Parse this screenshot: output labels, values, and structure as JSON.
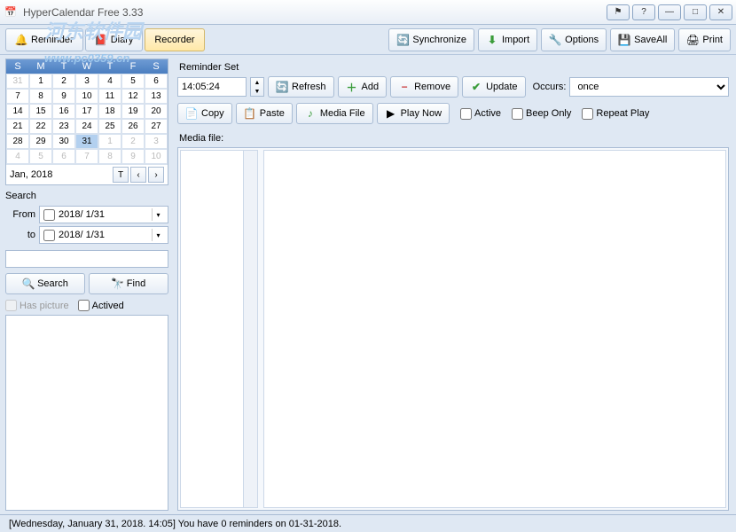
{
  "titlebar": {
    "title": "HyperCalendar Free 3.33",
    "watermark": "河东软件园\nwww.pc0359.cn"
  },
  "tabs": {
    "reminder": "Reminder",
    "diary": "Diary",
    "recorder": "Recorder"
  },
  "toolbar": {
    "synchronize": "Synchronize",
    "import": "Import",
    "options": "Options",
    "saveall": "SaveAll",
    "print": "Print"
  },
  "calendar": {
    "dow": [
      "S",
      "M",
      "T",
      "W",
      "T",
      "F",
      "S"
    ],
    "month_label": "Jan, 2018",
    "today_btn": "T",
    "cells": [
      {
        "d": "31",
        "dim": true
      },
      {
        "d": "1"
      },
      {
        "d": "2"
      },
      {
        "d": "3"
      },
      {
        "d": "4"
      },
      {
        "d": "5"
      },
      {
        "d": "6"
      },
      {
        "d": "7"
      },
      {
        "d": "8"
      },
      {
        "d": "9"
      },
      {
        "d": "10"
      },
      {
        "d": "11"
      },
      {
        "d": "12"
      },
      {
        "d": "13"
      },
      {
        "d": "14"
      },
      {
        "d": "15"
      },
      {
        "d": "16"
      },
      {
        "d": "17"
      },
      {
        "d": "18"
      },
      {
        "d": "19"
      },
      {
        "d": "20"
      },
      {
        "d": "21"
      },
      {
        "d": "22"
      },
      {
        "d": "23"
      },
      {
        "d": "24"
      },
      {
        "d": "25"
      },
      {
        "d": "26"
      },
      {
        "d": "27"
      },
      {
        "d": "28"
      },
      {
        "d": "29"
      },
      {
        "d": "30"
      },
      {
        "d": "31",
        "sel": true
      },
      {
        "d": "1",
        "dim": true
      },
      {
        "d": "2",
        "dim": true
      },
      {
        "d": "3",
        "dim": true
      },
      {
        "d": "4",
        "dim": true
      },
      {
        "d": "5",
        "dim": true
      },
      {
        "d": "6",
        "dim": true
      },
      {
        "d": "7",
        "dim": true
      },
      {
        "d": "8",
        "dim": true
      },
      {
        "d": "9",
        "dim": true
      },
      {
        "d": "10",
        "dim": true
      }
    ]
  },
  "search": {
    "title": "Search",
    "from_label": "From",
    "to_label": "to",
    "from_value": "2018/ 1/31",
    "to_value": "2018/ 1/31",
    "search_btn": "Search",
    "find_btn": "Find",
    "has_picture": "Has picture",
    "actived": "Actived"
  },
  "reminder": {
    "section": "Reminder Set",
    "time_value": "14:05:24",
    "refresh": "Refresh",
    "add": "Add",
    "remove": "Remove",
    "update": "Update",
    "occurs_label": "Occurs:",
    "occurs_value": "once",
    "copy": "Copy",
    "paste": "Paste",
    "media_file_btn": "Media File",
    "play_now": "Play Now",
    "active": "Active",
    "beep_only": "Beep Only",
    "repeat_play": "Repeat Play",
    "media_label": "Media file:"
  },
  "statusbar": {
    "text": "[Wednesday, January 31, 2018. 14:05] You have 0 reminders on 01-31-2018."
  }
}
